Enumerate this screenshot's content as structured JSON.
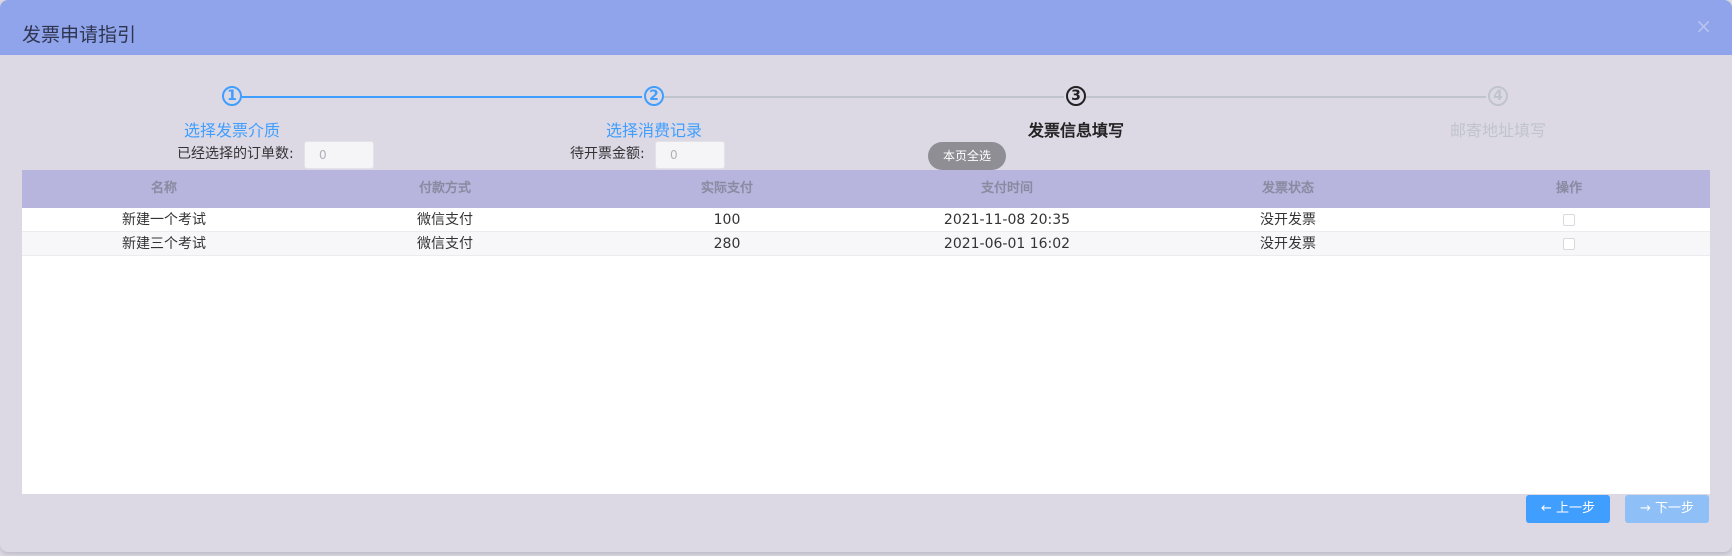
{
  "dialog": {
    "title": "发票申请指引",
    "close_glyph": "×"
  },
  "steps": [
    {
      "number": "1",
      "label": "选择发票介质",
      "state": "done"
    },
    {
      "number": "2",
      "label": "选择消费记录",
      "state": "done"
    },
    {
      "number": "3",
      "label": "发票信息填写",
      "state": "active"
    },
    {
      "number": "4",
      "label": "邮寄地址填写",
      "state": "pending"
    }
  ],
  "info": {
    "orders_selected_label": "已经选择的订单数:",
    "orders_selected_value": "0",
    "amount_label": "待开票金额:",
    "amount_value": "0",
    "select_all_label": "本页全选"
  },
  "table": {
    "headers": [
      "名称",
      "付款方式",
      "实际支付",
      "支付时间",
      "发票状态",
      "操作"
    ],
    "rows": [
      {
        "name": "新建一个考试",
        "pay_method": "微信支付",
        "amount": "100",
        "pay_time": "2021-11-08 20:35",
        "invoice_status": "没开发票",
        "checked": false
      },
      {
        "name": "新建三个考试",
        "pay_method": "微信支付",
        "amount": "280",
        "pay_time": "2021-06-01 16:02",
        "invoice_status": "没开发票",
        "checked": false
      }
    ]
  },
  "footer": {
    "prev_label": "← 上一步",
    "next_label": "→ 下一步"
  },
  "colors": {
    "header_bg": "#8fa4ea",
    "step_done": "#409eff",
    "step_active": "#222222",
    "step_pending": "#c0c4cc",
    "table_header_bg": "#b7b4de",
    "primary_button": "#409eff"
  }
}
